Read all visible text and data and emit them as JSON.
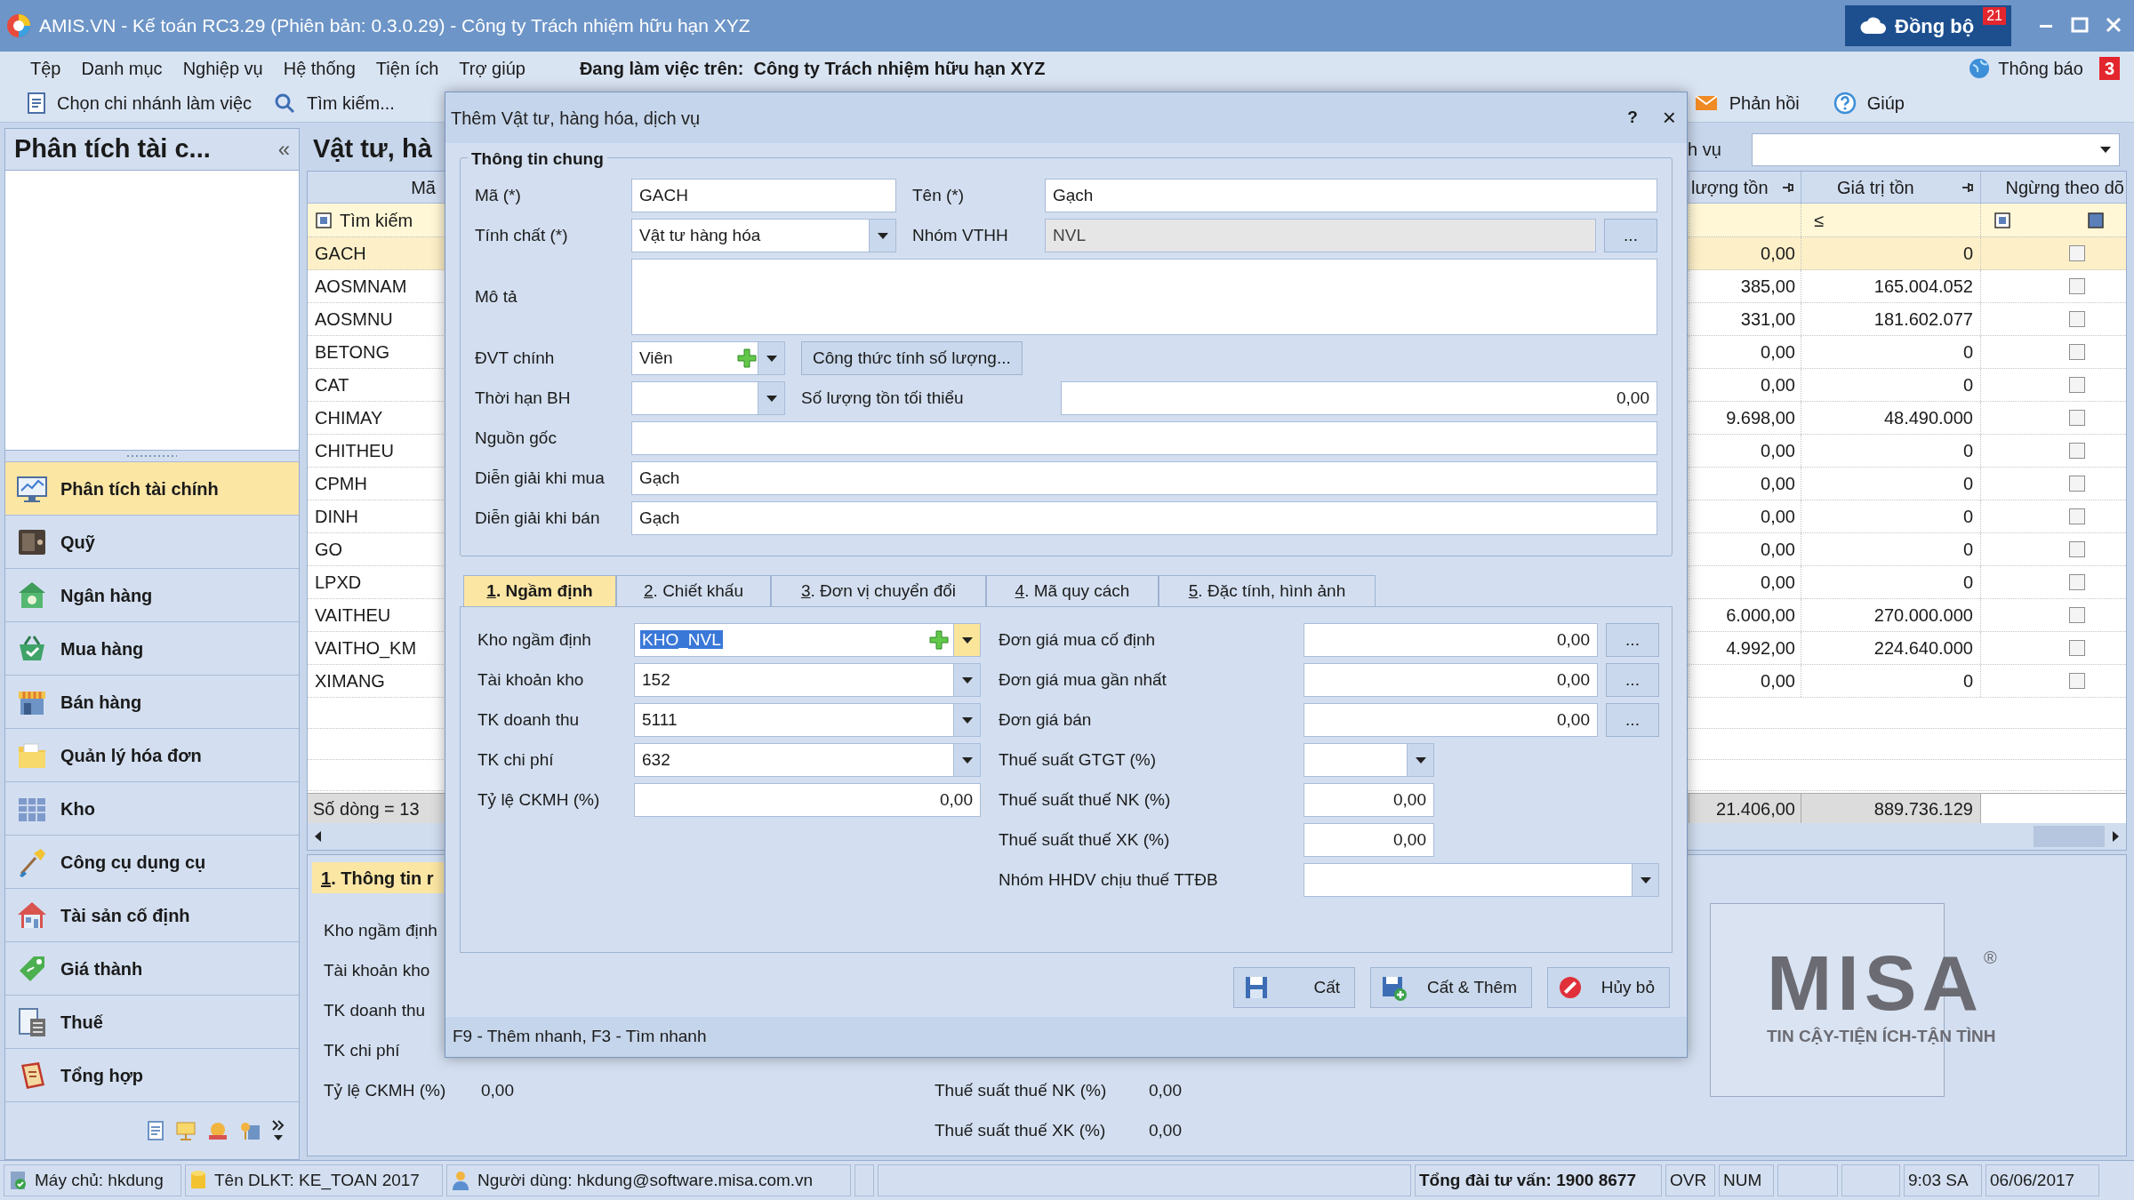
{
  "window": {
    "title": "AMIS.VN - Kế toán RC3.29 (Phiên bản: 0.3.0.29) - Công ty Trách nhiệm hữu hạn XYZ",
    "sync_button": "Đồng bộ",
    "sync_badge": "21"
  },
  "menu": {
    "items": [
      "Tệp",
      "Danh mục",
      "Nghiệp vụ",
      "Hệ thống",
      "Tiện ích",
      "Trợ giúp"
    ],
    "working_on": "Đang làm việc trên:  Công ty Trách nhiệm hữu hạn XYZ",
    "notifications": "Thông báo",
    "notifications_badge": "3"
  },
  "toolbar": {
    "left": [
      {
        "kind": "branch",
        "label": "Chọn chi nhánh làm việc"
      },
      {
        "kind": "search",
        "label": "Tìm kiếm..."
      }
    ],
    "right": [
      {
        "kind": "mail",
        "label": "Phản hồi"
      },
      {
        "kind": "help",
        "label": "Giúp"
      }
    ]
  },
  "sidebar": {
    "title": "Phân tích tài c...",
    "collapse": "«",
    "items": [
      {
        "label": "Phân tích tài chính",
        "kind": "monitor",
        "selected": true
      },
      {
        "label": "Quỹ",
        "kind": "safe",
        "selected": false
      },
      {
        "label": "Ngân hàng",
        "kind": "bank",
        "selected": false
      },
      {
        "label": "Mua hàng",
        "kind": "basket",
        "selected": false
      },
      {
        "label": "Bán hàng",
        "kind": "shop",
        "selected": false
      },
      {
        "label": "Quản lý hóa đơn",
        "kind": "folder",
        "selected": false
      },
      {
        "label": "Kho",
        "kind": "warehouse",
        "selected": false
      },
      {
        "label": "Công cụ dụng cụ",
        "kind": "tool",
        "selected": false
      },
      {
        "label": "Tài sản cố định",
        "kind": "house",
        "selected": false
      },
      {
        "label": "Giá thành",
        "kind": "tag",
        "selected": false
      },
      {
        "label": "Thuế",
        "kind": "calculator",
        "selected": false
      },
      {
        "label": "Tổng hợp",
        "kind": "book",
        "selected": false
      }
    ]
  },
  "list_panel": {
    "title": "Vật tư, hà",
    "filter_label": "h vụ",
    "columns": [
      "Mã",
      "lượng tồn",
      "Giá trị tồn",
      "Ngừng theo dõ"
    ],
    "search_placeholder": "Tìm kiếm",
    "filter_operator": "≤",
    "stop_filter_checked": true,
    "rows": [
      {
        "code": "GACH",
        "qty": "0,00",
        "value": "0",
        "stopped": false,
        "selected": true
      },
      {
        "code": "AOSMNAM",
        "qty": "385,00",
        "value": "165.004.052",
        "stopped": false,
        "selected": false
      },
      {
        "code": "AOSMNU",
        "qty": "331,00",
        "value": "181.602.077",
        "stopped": false,
        "selected": false
      },
      {
        "code": "BETONG",
        "qty": "0,00",
        "value": "0",
        "stopped": false,
        "selected": false
      },
      {
        "code": "CAT",
        "qty": "0,00",
        "value": "0",
        "stopped": false,
        "selected": false
      },
      {
        "code": "CHIMAY",
        "qty": "9.698,00",
        "value": "48.490.000",
        "stopped": false,
        "selected": false
      },
      {
        "code": "CHITHEU",
        "qty": "0,00",
        "value": "0",
        "stopped": false,
        "selected": false
      },
      {
        "code": "CPMH",
        "qty": "0,00",
        "value": "0",
        "stopped": false,
        "selected": false
      },
      {
        "code": "DINH",
        "qty": "0,00",
        "value": "0",
        "stopped": false,
        "selected": false
      },
      {
        "code": "GO",
        "qty": "0,00",
        "value": "0",
        "stopped": false,
        "selected": false
      },
      {
        "code": "LPXD",
        "qty": "0,00",
        "value": "0",
        "stopped": false,
        "selected": false
      },
      {
        "code": "VAITHEU",
        "qty": "6.000,00",
        "value": "270.000.000",
        "stopped": false,
        "selected": false
      },
      {
        "code": "VAITHO_KM",
        "qty": "4.992,00",
        "value": "224.640.000",
        "stopped": false,
        "selected": false
      },
      {
        "code": "XIMANG",
        "qty": "0,00",
        "value": "0",
        "stopped": false,
        "selected": false
      }
    ],
    "footer": {
      "count": "Số dòng = 13",
      "qty": "21.406,00",
      "value": "889.736.129"
    }
  },
  "detail_panel": {
    "tab": {
      "key": "1",
      "text": ". Thông tin r"
    },
    "left": [
      {
        "label": "Kho ngầm định"
      },
      {
        "label": "Tài khoản kho"
      },
      {
        "label": "TK doanh thu"
      },
      {
        "label": "TK chi phí"
      },
      {
        "label": "Tỷ lệ CKMH (%)",
        "value": "0,00"
      }
    ],
    "right": [
      {
        "label": "Thuế suất thuế NK (%)",
        "value": "0,00"
      },
      {
        "label": "Thuế suất thuế XK (%)",
        "value": "0,00"
      }
    ]
  },
  "logo": {
    "name": "MISA",
    "registered": "®",
    "tagline": "TIN CẬY-TIỆN ÍCH-TẬN TÌNH"
  },
  "dialog": {
    "title": "Thêm Vật tư, hàng hóa, dịch vụ",
    "help": "?",
    "close": "×",
    "group": "Thông tin chung",
    "code": {
      "label": "Mã (*)",
      "value": "GACH"
    },
    "name": {
      "label": "Tên (*)",
      "value": "Gạch"
    },
    "nature": {
      "label": "Tính chất (*)",
      "value": "Vật tư hàng hóa"
    },
    "item_group": {
      "label": "Nhóm VTHH",
      "value": "NVL",
      "disabled": true,
      "browse": "..."
    },
    "description": {
      "label": "Mô tả"
    },
    "unit": {
      "label": "ĐVT chính",
      "value": "Viên"
    },
    "formula_button": "Công thức tính số lượng...",
    "warranty": {
      "label": "Thời hạn BH"
    },
    "min_stock": {
      "label": "Số lượng tồn tối thiểu",
      "value": "0,00"
    },
    "origin": {
      "label": "Nguồn gốc"
    },
    "purchase_desc": {
      "label": "Diễn giải khi mua",
      "value": "Gạch"
    },
    "sale_desc": {
      "label": "Diễn giải khi bán",
      "value": "Gạch"
    },
    "tabs": [
      {
        "key": "1",
        "text": ". Ngầm định",
        "selected": true
      },
      {
        "key": "2",
        "text": ". Chiết khấu",
        "selected": false
      },
      {
        "key": "3",
        "text": ". Đơn vị chuyển đổi",
        "selected": false
      },
      {
        "key": "4",
        "text": ". Mã quy cách",
        "selected": false
      },
      {
        "key": "5",
        "text": ". Đặc tính, hình ảnh",
        "selected": false
      }
    ],
    "defaults_left": [
      {
        "kind": "combo_add",
        "label": "Kho ngầm định",
        "value": "KHO_NVL",
        "highlighted": true
      },
      {
        "kind": "combo",
        "label": "Tài khoản kho",
        "value": "152"
      },
      {
        "kind": "combo",
        "label": "TK doanh thu",
        "value": "5111"
      },
      {
        "kind": "combo",
        "label": "TK chi phí",
        "value": "632"
      },
      {
        "kind": "number",
        "label": "Tỷ lệ CKMH (%)",
        "value": "0,00"
      }
    ],
    "defaults_right": [
      {
        "kind": "number_browse",
        "label": "Đơn giá mua cố định",
        "value": "0,00",
        "browse": "..."
      },
      {
        "kind": "number_browse",
        "label": "Đơn giá mua gần nhất",
        "value": "0,00",
        "browse": "..."
      },
      {
        "kind": "number_browse",
        "label": "Đơn giá bán",
        "value": "0,00",
        "browse": "..."
      },
      {
        "kind": "short_combo",
        "label": "Thuế suất GTGT (%)"
      },
      {
        "kind": "short_number",
        "label": "Thuế suất thuế NK (%)",
        "value": "0,00"
      },
      {
        "kind": "short_number",
        "label": "Thuế suất thuế XK (%)",
        "value": "0,00"
      },
      {
        "kind": "wide_combo",
        "label": "Nhóm HHDV chịu thuế TTĐB"
      }
    ],
    "buttons": [
      {
        "kind": "save",
        "label": "Cất"
      },
      {
        "kind": "save_add",
        "label": "Cất & Thêm"
      },
      {
        "kind": "cancel",
        "label": "Hủy bỏ"
      }
    ],
    "hint": "F9 - Thêm nhanh, F3 - Tìm nhanh"
  },
  "status_bar": [
    {
      "kind": "server",
      "text": "Máy chủ: hkdung"
    },
    {
      "kind": "database",
      "text": "Tên DLKT: KE_TOAN 2017"
    },
    {
      "kind": "user",
      "text": "Người dùng: hkdung@software.misa.com.vn"
    },
    {
      "kind": "blank"
    },
    {
      "kind": "blank"
    },
    {
      "kind": "hotline",
      "text": "Tổng đài tư vấn: 1900 8677"
    },
    {
      "kind": "plain",
      "text": "OVR"
    },
    {
      "kind": "plain",
      "text": "NUM"
    },
    {
      "kind": "blank"
    },
    {
      "kind": "blank"
    },
    {
      "kind": "plain",
      "text": "9:03 SA"
    },
    {
      "kind": "plain",
      "text": "06/06/2017"
    }
  ]
}
